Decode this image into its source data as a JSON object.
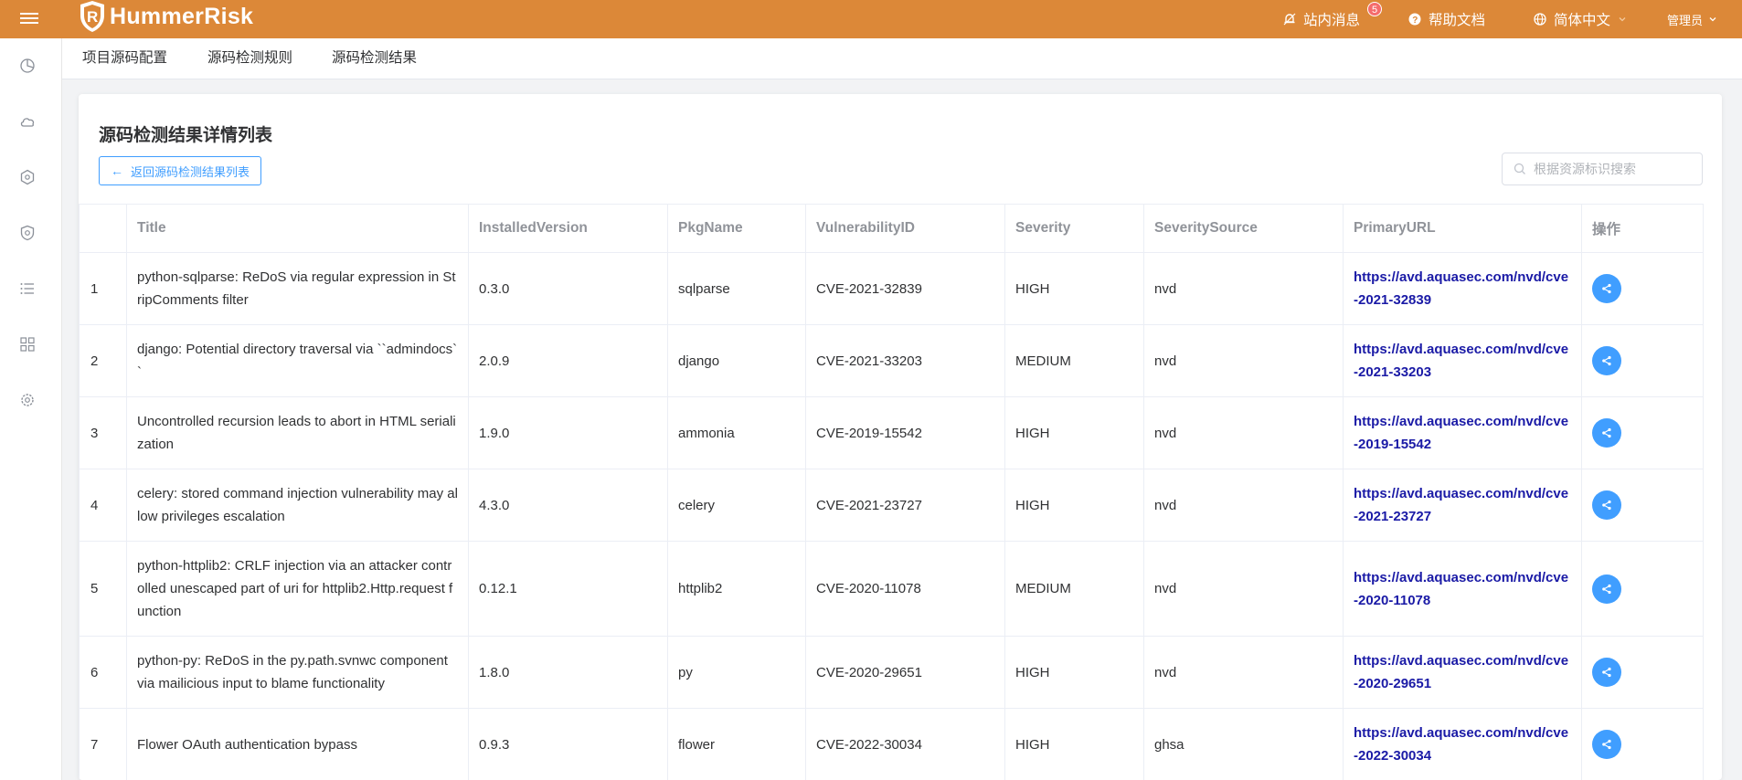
{
  "app": {
    "name": "HummerRisk"
  },
  "header": {
    "notifications_label": "站内消息",
    "notifications_count": "5",
    "help_label": "帮助文档",
    "language_label": "简体中文",
    "user_label": "管理员"
  },
  "sidebar": {
    "icons": [
      "dashboard-icon",
      "cloud-icon",
      "cluster-icon",
      "shield-icon",
      "list-icon",
      "grid-icon",
      "settings-icon"
    ]
  },
  "tabs": [
    "项目源码配置",
    "源码检测规则",
    "源码检测结果"
  ],
  "main": {
    "title": "源码检测结果详情列表",
    "back_button": "返回源码检测结果列表",
    "search_placeholder": "根据资源标识搜索"
  },
  "table": {
    "headers": [
      "",
      "Title",
      "InstalledVersion",
      "PkgName",
      "VulnerabilityID",
      "Severity",
      "SeveritySource",
      "PrimaryURL",
      "操作"
    ],
    "rows": [
      {
        "index": "1",
        "title": "python-sqlparse: ReDoS via regular expression in StripComments filter",
        "installed_version": "0.3.0",
        "pkg_name": "sqlparse",
        "vulnerability_id": "CVE-2021-32839",
        "severity": "HIGH",
        "severity_source": "nvd",
        "primary_url": "https://avd.aquasec.com/nvd/cve-2021-32839"
      },
      {
        "index": "2",
        "title": "django: Potential directory traversal via ``admindocs``",
        "installed_version": "2.0.9",
        "pkg_name": "django",
        "vulnerability_id": "CVE-2021-33203",
        "severity": "MEDIUM",
        "severity_source": "nvd",
        "primary_url": "https://avd.aquasec.com/nvd/cve-2021-33203"
      },
      {
        "index": "3",
        "title": "Uncontrolled recursion leads to abort in HTML serialization",
        "installed_version": "1.9.0",
        "pkg_name": "ammonia",
        "vulnerability_id": "CVE-2019-15542",
        "severity": "HIGH",
        "severity_source": "nvd",
        "primary_url": "https://avd.aquasec.com/nvd/cve-2019-15542"
      },
      {
        "index": "4",
        "title": "celery: stored command injection vulnerability may allow privileges escalation",
        "installed_version": "4.3.0",
        "pkg_name": "celery",
        "vulnerability_id": "CVE-2021-23727",
        "severity": "HIGH",
        "severity_source": "nvd",
        "primary_url": "https://avd.aquasec.com/nvd/cve-2021-23727"
      },
      {
        "index": "5",
        "title": "python-httplib2: CRLF injection via an attacker controlled unescaped part of uri for httplib2.Http.request function",
        "installed_version": "0.12.1",
        "pkg_name": "httplib2",
        "vulnerability_id": "CVE-2020-11078",
        "severity": "MEDIUM",
        "severity_source": "nvd",
        "primary_url": "https://avd.aquasec.com/nvd/cve-2020-11078"
      },
      {
        "index": "6",
        "title": "python-py: ReDoS in the py.path.svnwc component via mailicious input to blame functionality",
        "installed_version": "1.8.0",
        "pkg_name": "py",
        "vulnerability_id": "CVE-2020-29651",
        "severity": "HIGH",
        "severity_source": "nvd",
        "primary_url": "https://avd.aquasec.com/nvd/cve-2020-29651"
      },
      {
        "index": "7",
        "title": "Flower OAuth authentication bypass",
        "installed_version": "0.9.3",
        "pkg_name": "flower",
        "vulnerability_id": "CVE-2022-30034",
        "severity": "HIGH",
        "severity_source": "ghsa",
        "primary_url": "https://avd.aquasec.com/nvd/cve-2022-30034"
      }
    ]
  },
  "colors": {
    "header_bg": "#dc8838",
    "primary": "#409eff",
    "link": "#1a1aa6"
  }
}
